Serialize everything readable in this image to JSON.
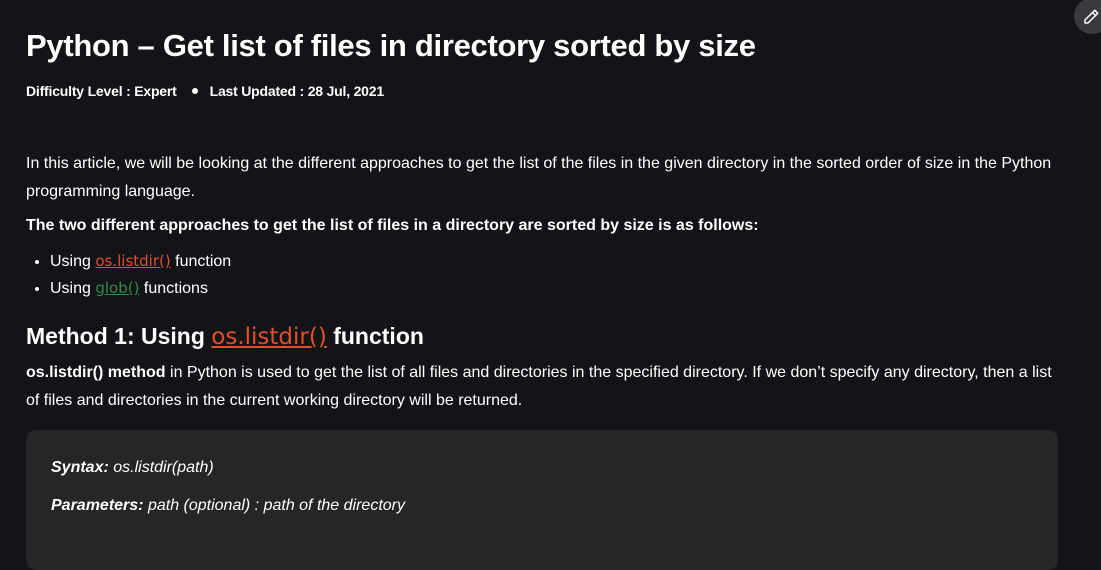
{
  "article": {
    "title": "Python – Get list of files in directory sorted by size",
    "difficulty": "Difficulty Level : Expert",
    "last_updated": "Last Updated : 28 Jul, 2021",
    "intro": "In this article, we will be looking at the different approaches to get the list of the files in the given directory in the sorted order of size in the Python programming language.",
    "lead": "The two different approaches to get the list of files in a directory are sorted by size is as follows:",
    "approaches": [
      {
        "prefix": "Using ",
        "link": "os.listdir()",
        "suffix": " function"
      },
      {
        "prefix": "Using ",
        "link": "glob()",
        "suffix": " functions"
      }
    ],
    "method1": {
      "prefix": "Method 1: Using ",
      "link": "os.listdir()",
      "suffix": " function"
    },
    "method1_desc": {
      "bold": "os.listdir() method",
      "rest": " in Python is used to get the list of all files and directories in the specified directory. If we don’t specify any directory, then a list of files and directories in the current working directory will be returned."
    },
    "syntax": {
      "label": "Syntax:",
      "value": " os.listdir(path)"
    },
    "parameters": {
      "label": "Parameters:",
      "value": " path (optional) : path of the directory"
    }
  },
  "toolbar": {
    "edit_icon": "pencil-icon"
  }
}
